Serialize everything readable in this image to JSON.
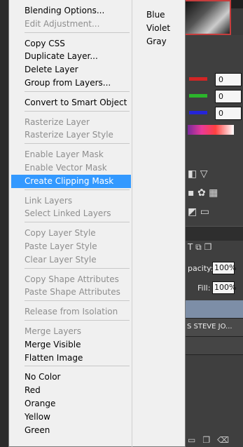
{
  "menu": {
    "groups": [
      [
        {
          "label": "Blending Options...",
          "enabled": true
        },
        {
          "label": "Edit Adjustment...",
          "enabled": false
        }
      ],
      [
        {
          "label": "Copy CSS",
          "enabled": true
        },
        {
          "label": "Duplicate Layer...",
          "enabled": true
        },
        {
          "label": "Delete Layer",
          "enabled": true
        },
        {
          "label": "Group from Layers...",
          "enabled": true
        }
      ],
      [
        {
          "label": "Convert to Smart Object",
          "enabled": true
        }
      ],
      [
        {
          "label": "Rasterize Layer",
          "enabled": false
        },
        {
          "label": "Rasterize Layer Style",
          "enabled": false
        }
      ],
      [
        {
          "label": "Enable Layer Mask",
          "enabled": false
        },
        {
          "label": "Enable Vector Mask",
          "enabled": false
        },
        {
          "label": "Create Clipping Mask",
          "enabled": true,
          "highlighted": true
        }
      ],
      [
        {
          "label": "Link Layers",
          "enabled": false
        },
        {
          "label": "Select Linked Layers",
          "enabled": false
        }
      ],
      [
        {
          "label": "Copy Layer Style",
          "enabled": false
        },
        {
          "label": "Paste Layer Style",
          "enabled": false
        },
        {
          "label": "Clear Layer Style",
          "enabled": false
        }
      ],
      [
        {
          "label": "Copy Shape Attributes",
          "enabled": false
        },
        {
          "label": "Paste Shape Attributes",
          "enabled": false
        }
      ],
      [
        {
          "label": "Release from Isolation",
          "enabled": false
        }
      ],
      [
        {
          "label": "Merge Layers",
          "enabled": false
        },
        {
          "label": "Merge Visible",
          "enabled": true
        },
        {
          "label": "Flatten Image",
          "enabled": true
        }
      ],
      [
        {
          "label": "No Color",
          "enabled": true
        },
        {
          "label": "Red",
          "enabled": true
        },
        {
          "label": "Orange",
          "enabled": true
        },
        {
          "label": "Yellow",
          "enabled": true
        },
        {
          "label": "Green",
          "enabled": true
        }
      ]
    ],
    "side_items": [
      "Blue",
      "Violet",
      "Gray"
    ]
  },
  "color_panel": {
    "channels": [
      {
        "value": "0",
        "color": "#d22525"
      },
      {
        "value": "0",
        "color": "#2bb52b"
      },
      {
        "value": "0",
        "color": "#2424d8"
      }
    ]
  },
  "layers_panel": {
    "opacity_label": "pacity:",
    "opacity_value": "100%",
    "fill_label": "Fill:",
    "fill_value": "100%",
    "text_layer_name": "S STEVE JO..."
  },
  "colors": {
    "highlight": "#3399ff",
    "selected_layer": "#7d8ea7"
  }
}
